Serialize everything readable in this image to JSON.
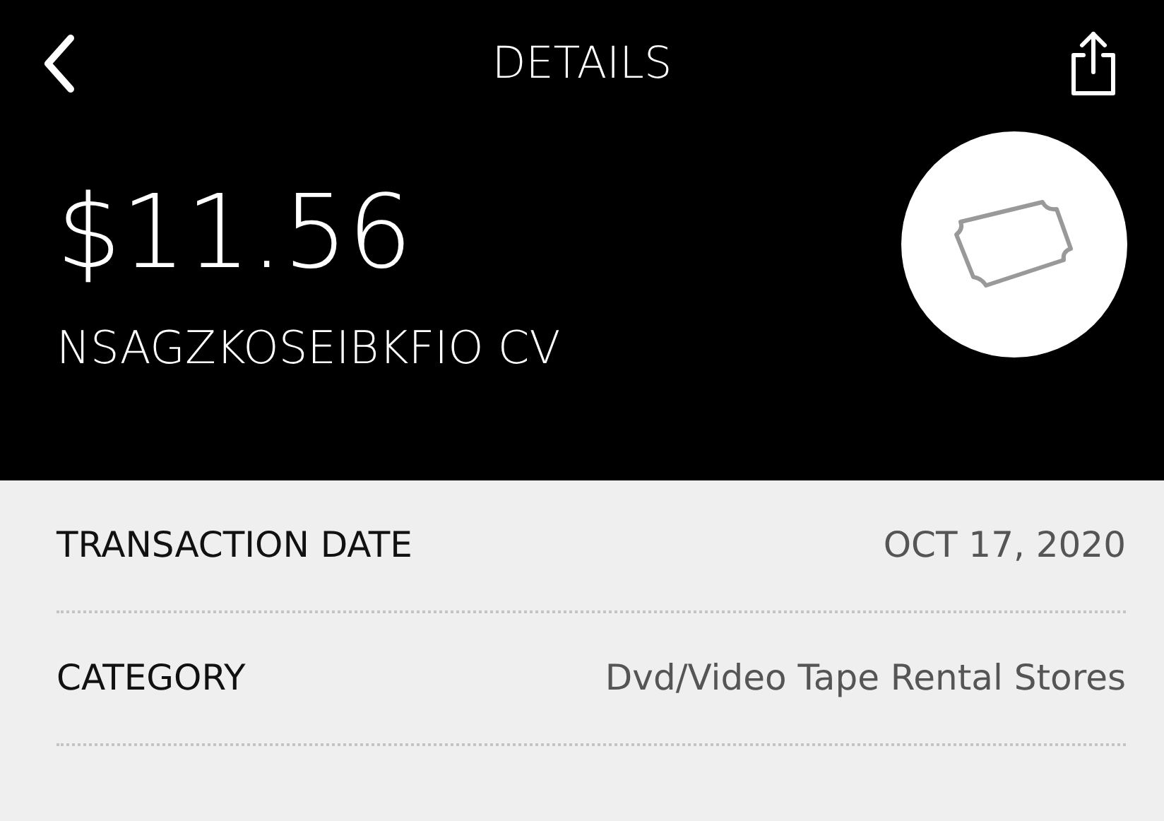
{
  "header": {
    "title": "DETAILS"
  },
  "summary": {
    "amount": "$11.56",
    "merchant": "NSAGZKOSEIBKFIO CV"
  },
  "details": [
    {
      "label": "TRANSACTION DATE",
      "value": "OCT 17, 2020"
    },
    {
      "label": "CATEGORY",
      "value": "Dvd/Video Tape Rental Stores"
    }
  ]
}
